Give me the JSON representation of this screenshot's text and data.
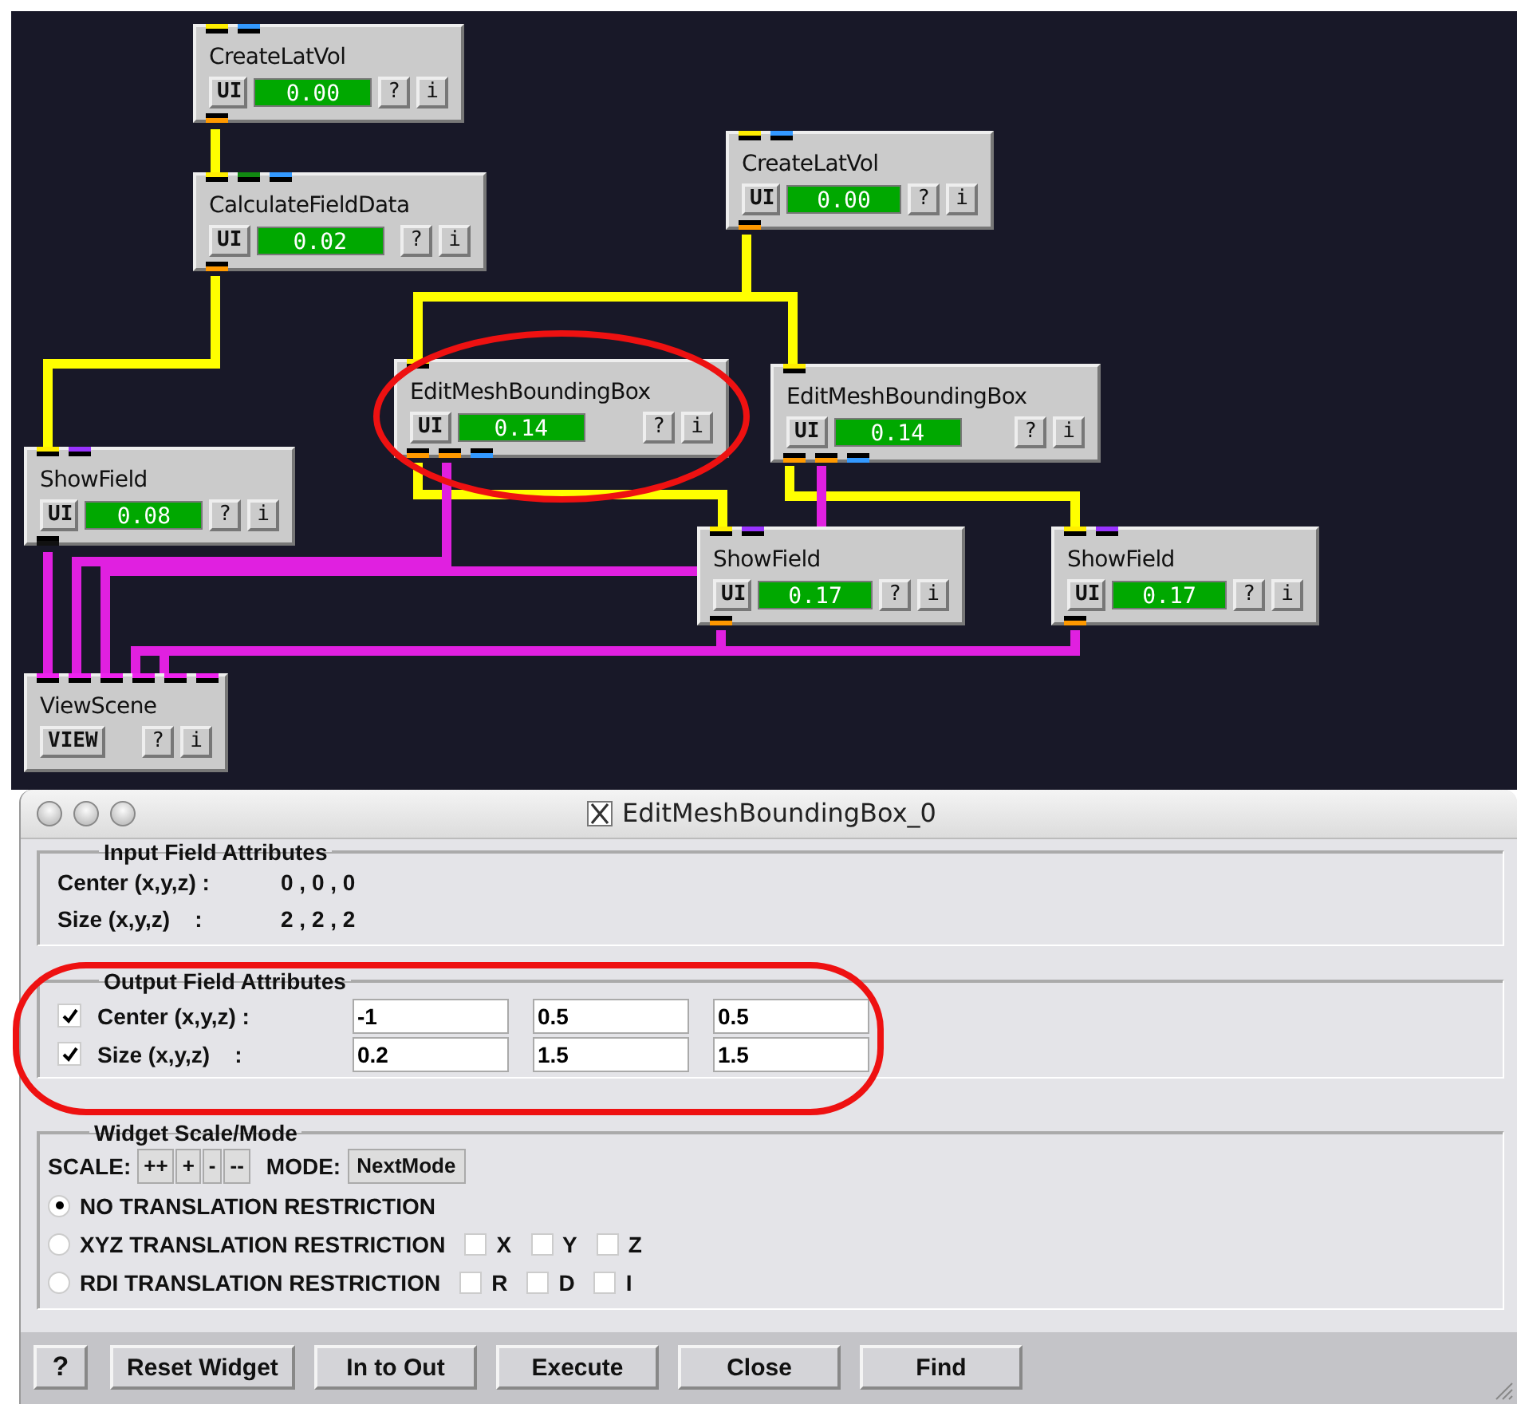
{
  "canvas": {
    "modules": [
      {
        "name": "CreateLatVol",
        "kind": "timed",
        "ui_button": "UI",
        "time": "0.00",
        "help": "?",
        "info": "i"
      },
      {
        "name": "CalculateFieldData",
        "kind": "timed",
        "ui_button": "UI",
        "time": "0.02",
        "help": "?",
        "info": "i"
      },
      {
        "name": "EditMeshBoundingBox",
        "kind": "timed",
        "ui_button": "UI",
        "time": "0.14",
        "help": "?",
        "info": "i"
      },
      {
        "name": "CreateLatVol",
        "kind": "timed",
        "ui_button": "UI",
        "time": "0.00",
        "help": "?",
        "info": "i"
      },
      {
        "name": "EditMeshBoundingBox",
        "kind": "timed",
        "ui_button": "UI",
        "time": "0.14",
        "help": "?",
        "info": "i"
      },
      {
        "name": "ShowField",
        "kind": "timed",
        "ui_button": "UI",
        "time": "0.08",
        "help": "?",
        "info": "i"
      },
      {
        "name": "ShowField",
        "kind": "timed",
        "ui_button": "UI",
        "time": "0.17",
        "help": "?",
        "info": "i"
      },
      {
        "name": "ShowField",
        "kind": "timed",
        "ui_button": "UI",
        "time": "0.17",
        "help": "?",
        "info": "i"
      },
      {
        "name": "ViewScene",
        "kind": "view",
        "ui_button": "VIEW",
        "help": "?",
        "info": "i"
      }
    ]
  },
  "dialog": {
    "title": "EditMeshBoundingBox_0",
    "input_group": {
      "title": "Input Field Attributes",
      "rows": [
        {
          "label": "Center (x,y,z) :",
          "value": "0 , 0 , 0"
        },
        {
          "label": "Size (x,y,z)    :",
          "value": "2 , 2 , 2"
        }
      ]
    },
    "output_group": {
      "title": "Output Field Attributes",
      "rows": [
        {
          "checked": true,
          "label": "Center (x,y,z) :",
          "values": [
            "-1",
            "0.5",
            "0.5"
          ]
        },
        {
          "checked": true,
          "label": "Size (x,y,z)    :",
          "values": [
            "0.2",
            "1.5",
            "1.5"
          ]
        }
      ]
    },
    "widget_group": {
      "title": "Widget Scale/Mode",
      "scale_label": "SCALE:",
      "scale_buttons": [
        "++",
        "+",
        "-",
        "--"
      ],
      "mode_label": "MODE:",
      "mode_button": "NextMode",
      "restrictions": [
        {
          "label": "NO TRANSLATION RESTRICTION",
          "selected": true
        },
        {
          "label": "XYZ TRANSLATION RESTRICTION",
          "selected": false,
          "axes": [
            {
              "label": "X",
              "checked": false
            },
            {
              "label": "Y",
              "checked": false
            },
            {
              "label": "Z",
              "checked": false
            }
          ]
        },
        {
          "label": "RDI TRANSLATION RESTRICTION",
          "selected": false,
          "axes": [
            {
              "label": "R",
              "checked": false
            },
            {
              "label": "D",
              "checked": false
            },
            {
              "label": "I",
              "checked": false
            }
          ]
        }
      ]
    },
    "help_button": "?",
    "buttons": [
      "Reset Widget",
      "In to Out",
      "Execute",
      "Close",
      "Find"
    ]
  }
}
